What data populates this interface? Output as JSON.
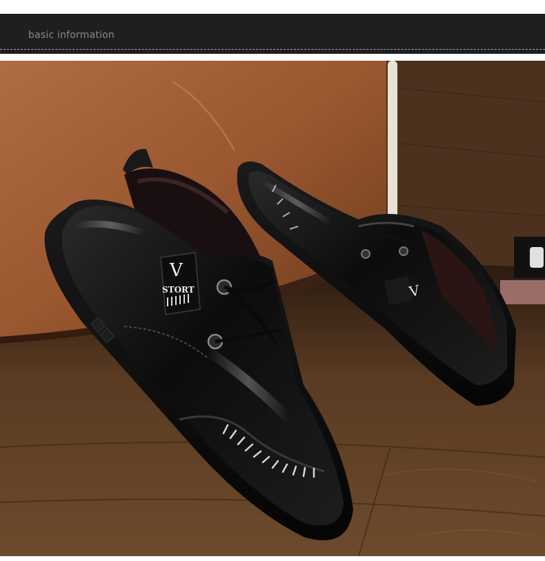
{
  "header": {
    "title": "basic information"
  },
  "photo": {
    "logo_letter": "V",
    "logo_text": "STORT"
  }
}
